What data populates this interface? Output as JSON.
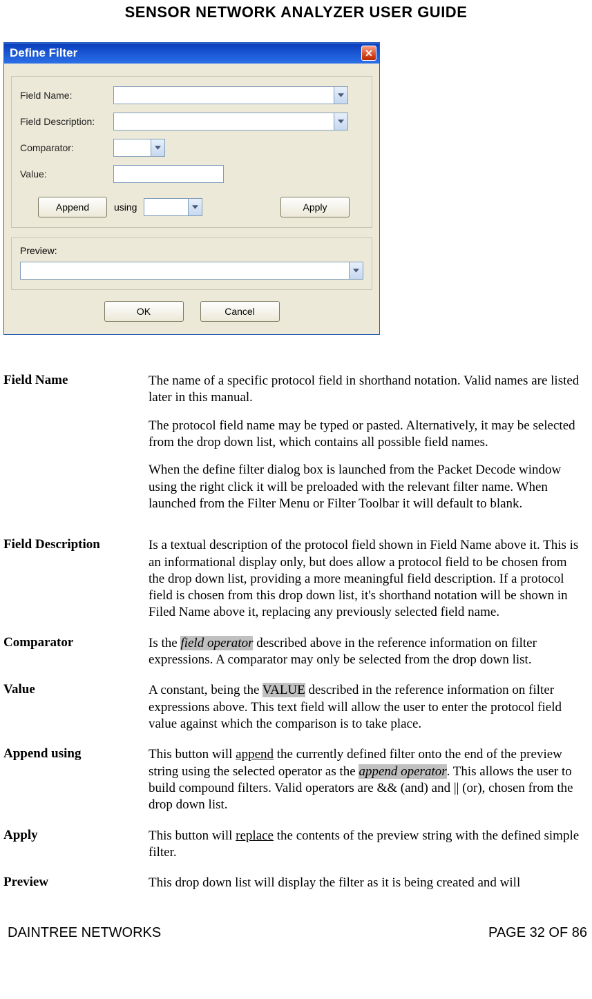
{
  "header": "SENSOR NETWORK ANALYZER USER GUIDE",
  "dialog": {
    "title": "Define Filter",
    "close_glyph": "✕",
    "labels": {
      "field_name": "Field Name:",
      "field_description": "Field Description:",
      "comparator": "Comparator:",
      "value": "Value:",
      "using": "using",
      "preview": "Preview:"
    },
    "buttons": {
      "append": "Append",
      "apply": "Apply",
      "ok": "OK",
      "cancel": "Cancel"
    }
  },
  "defs": {
    "field_name": {
      "term": "Field Name",
      "p1": "The name of a specific protocol field in shorthand notation.  Valid names are listed later in this manual.",
      "p2": "The protocol field name may be typed or pasted.  Alternatively, it may be selected from the drop down list, which contains all possible field names.",
      "p3": "When the define filter dialog box is launched from the Packet Decode window using the right click it will be preloaded with the relevant filter name. When launched from the Filter Menu or Filter Toolbar it will default to blank."
    },
    "field_description": {
      "term": "Field Description",
      "p1": "Is a textual description of the protocol field shown in Field Name above it. This is an informational display only, but does allow a protocol field to be chosen from the drop down list, providing a more meaningful field description.  If a protocol field is chosen from this drop down list, it's shorthand notation will be shown in Filed Name above it, replacing any previously selected field name."
    },
    "comparator": {
      "term": "Comparator",
      "pre": "Is the ",
      "hi": "field operator",
      "post": " described above in the reference information on filter expressions.  A comparator may only be selected from the drop down list."
    },
    "value": {
      "term": "Value",
      "pre": "A constant, being the ",
      "hi": "VALUE",
      "post": " described in the reference information on filter expressions above.  This text field will allow the user to enter the protocol field value against which the comparison is to take place."
    },
    "append": {
      "term": "Append  using",
      "pre": "This button will ",
      "u": "append",
      "mid": " the currently defined filter onto the end of the preview string using the selected operator as the ",
      "hi": "append operator",
      "post": ". This allows the user to build compound filters.  Valid operators are && (and) and || (or), chosen from the drop down list."
    },
    "apply": {
      "term": "Apply",
      "pre": "This button will ",
      "u": "replace",
      "post": " the contents of the preview string with the defined simple filter."
    },
    "preview": {
      "term": "Preview",
      "p1": "This drop down list will display the filter as it is being created and will"
    }
  },
  "footer": {
    "left": "DAINTREE NETWORKS",
    "right": "PAGE 32 OF 86"
  }
}
